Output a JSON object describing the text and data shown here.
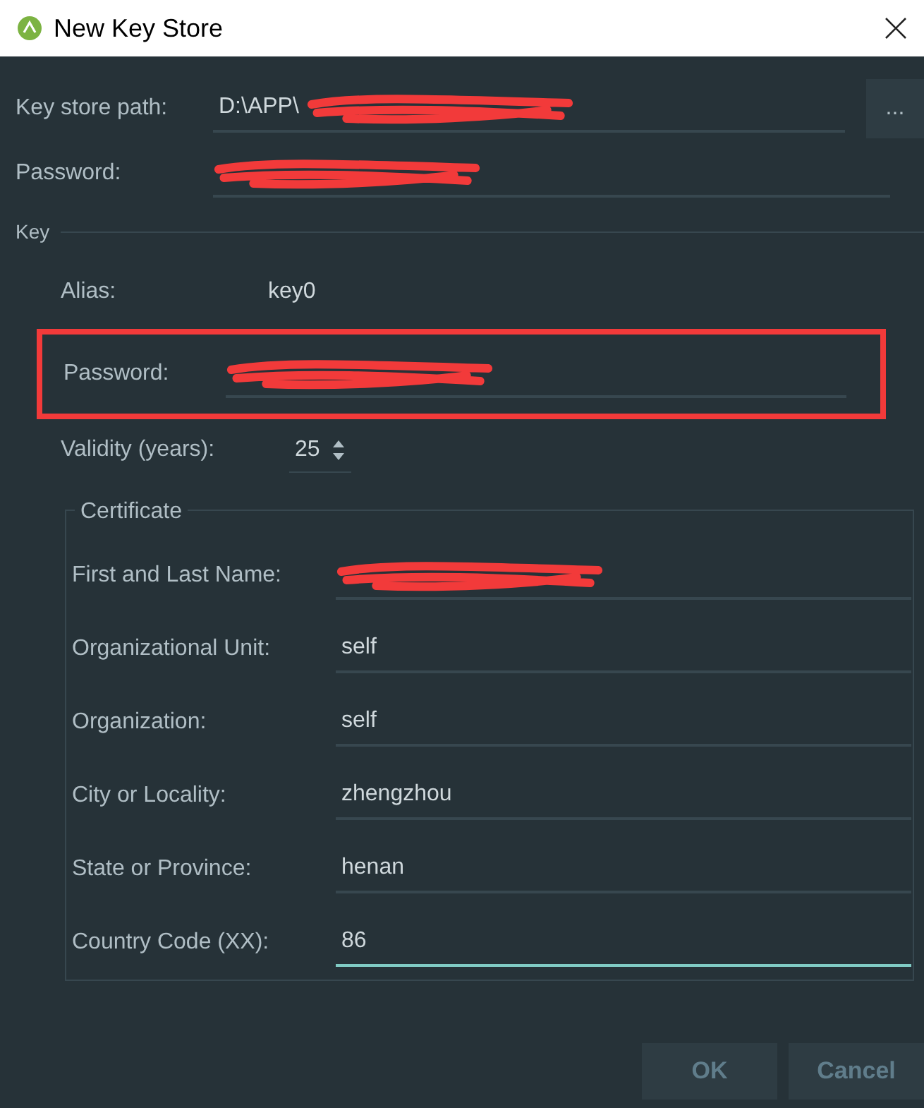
{
  "window": {
    "title": "New Key Store"
  },
  "keystore": {
    "path": {
      "label": "Key store path:",
      "value": "D:\\APP\\",
      "redacted": true
    },
    "password": {
      "label": "Password:",
      "redacted": true
    },
    "browse_button": "..."
  },
  "key": {
    "title": "Key",
    "alias": {
      "label": "Alias:",
      "value": "key0"
    },
    "password": {
      "label": "Password:",
      "redacted": true,
      "highlighted": true
    },
    "validity": {
      "label": "Validity (years):",
      "value": "25"
    }
  },
  "certificate": {
    "title": "Certificate",
    "fields": [
      {
        "label": "First and Last Name:",
        "redacted": true,
        "focused": false
      },
      {
        "label": "Organizational Unit:",
        "value": "self",
        "redacted": false,
        "focused": false
      },
      {
        "label": "Organization:",
        "value": "self",
        "redacted": false,
        "focused": false
      },
      {
        "label": "City or Locality:",
        "value": "zhengzhou",
        "redacted": false,
        "focused": false
      },
      {
        "label": "State or Province:",
        "value": "henan",
        "redacted": false,
        "focused": false
      },
      {
        "label": "Country Code (XX):",
        "value": "86",
        "redacted": false,
        "focused": true
      }
    ]
  },
  "buttons": [
    {
      "label": "OK"
    },
    {
      "label": "Cancel"
    }
  ]
}
